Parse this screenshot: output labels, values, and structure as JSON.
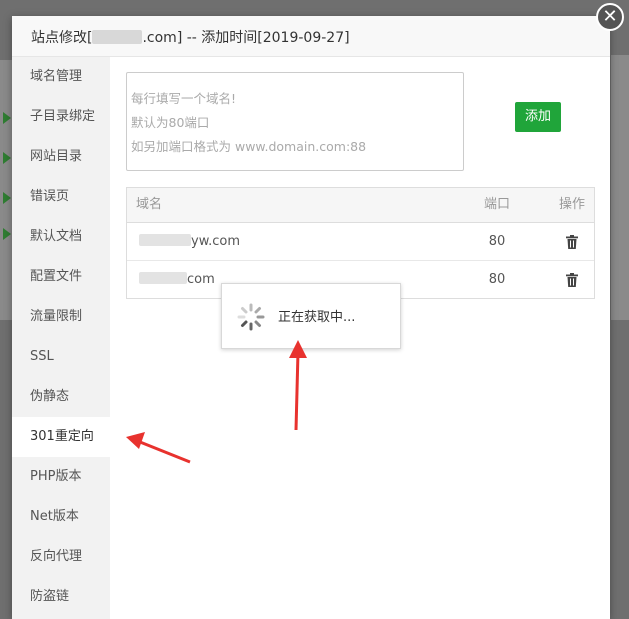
{
  "dialog": {
    "title_prefix": "站点修改[",
    "title_suffix": ".com] -- 添加时间[2019-09-27]",
    "close_glyph": "✕"
  },
  "sidebar": {
    "items": [
      {
        "label": "域名管理"
      },
      {
        "label": "子目录绑定"
      },
      {
        "label": "网站目录"
      },
      {
        "label": "错误页"
      },
      {
        "label": "默认文档"
      },
      {
        "label": "配置文件"
      },
      {
        "label": "流量限制"
      },
      {
        "label": "SSL"
      },
      {
        "label": "伪静态"
      },
      {
        "label": "301重定向"
      },
      {
        "label": "PHP版本"
      },
      {
        "label": "Net版本"
      },
      {
        "label": "反向代理"
      },
      {
        "label": "防盗链"
      }
    ],
    "active_index": 9
  },
  "domain_input": {
    "placeholder_lines": [
      "每行填写一个域名!",
      "默认为80端口",
      "如另加端口格式为 www.domain.com:88"
    ]
  },
  "add_button": {
    "label": "添加"
  },
  "table": {
    "headers": {
      "name": "域名",
      "port": "端口",
      "op": "操作"
    },
    "rows": [
      {
        "name_suffix": "yw.com",
        "port": "80",
        "icon": "trash-icon"
      },
      {
        "name_suffix": "com",
        "port": "80",
        "icon": "trash-icon"
      }
    ]
  },
  "loading": {
    "text": "正在获取中..."
  },
  "colors": {
    "accent": "#20a53a",
    "annotation": "#e8322e"
  }
}
